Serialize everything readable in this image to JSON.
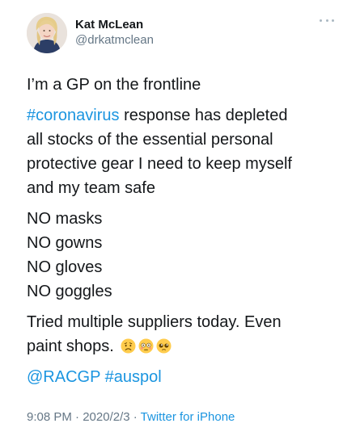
{
  "author": {
    "name": "Kat McLean",
    "handle": "@drkatmclean"
  },
  "tweet": {
    "line1": "I’m a GP on the frontline",
    "hashtag1": "#coronavirus",
    "p2_rest_l1": " response has depleted",
    "p2_l2": "all stocks of the essential personal",
    "p2_l3": "protective gear I need to keep myself",
    "p2_l4": "and my team safe",
    "no_list": [
      "NO masks",
      "NO gowns",
      "NO gloves",
      "NO goggles"
    ],
    "p4_l1": "Tried multiple suppliers today.  Even",
    "p4_l2": "paint shops.",
    "mention": "@RACGP",
    "hashtag2": "#auspol"
  },
  "meta": {
    "time": "9:08 PM",
    "sep1": " · ",
    "date": "2020/2/3",
    "sep2": " · ",
    "app": "Twitter for iPhone"
  },
  "icons": {
    "more": "more-horizontal-icon",
    "emojis": [
      "worried-face",
      "flushed-face",
      "pleading-face"
    ]
  },
  "colors": {
    "link": "#1b95e0",
    "text": "#14171a",
    "muted": "#657786"
  }
}
